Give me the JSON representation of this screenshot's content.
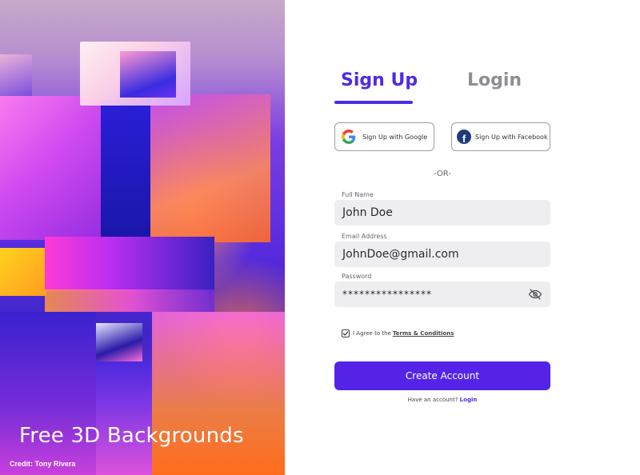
{
  "hero": {
    "title": "Free 3D Backgrounds",
    "credit": "Credit: Tony Rivera"
  },
  "tabs": {
    "signup": "Sign Up",
    "login": "Login",
    "active": "signup"
  },
  "social": {
    "google_label": "Sign Up with Google",
    "facebook_label": "Sign Up with Facebook",
    "google_icon": "google-logo-icon",
    "facebook_icon": "facebook-logo-icon"
  },
  "divider": "-OR-",
  "form": {
    "full_name": {
      "label": "Full Name",
      "value": "John Doe"
    },
    "email": {
      "label": "Email Address",
      "value": "JohnDoe@gmail.com"
    },
    "password": {
      "label": "Password",
      "value": "****************",
      "toggle_icon": "eye-off-icon"
    }
  },
  "agreement": {
    "text": "I Agree to the",
    "link": "Terms & Conditions",
    "checked": true
  },
  "submit_label": "Create Account",
  "footer": {
    "text": "Have an account?",
    "link": "Login"
  },
  "colors": {
    "accent": "#4f2ae8",
    "button": "#5523e8",
    "field_bg": "#eeeef1",
    "facebook": "#1f3b7a"
  }
}
